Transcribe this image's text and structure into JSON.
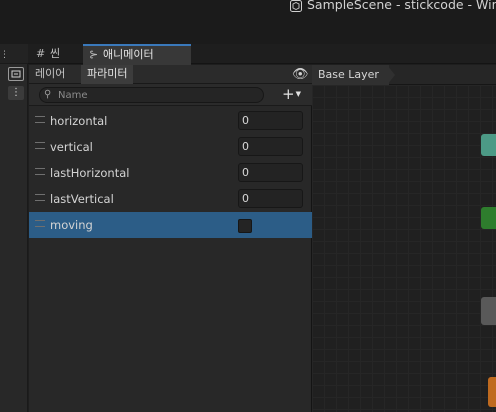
{
  "window": {
    "title": "SampleScene - stickcode - Win"
  },
  "tabs": [
    {
      "label": "씬",
      "icon": "grid-icon"
    },
    {
      "label": "애니메이터",
      "icon": "animator-icon",
      "active": true
    }
  ],
  "animator": {
    "subtabs": {
      "layers": "레이어",
      "parameters": "파라미터"
    },
    "search": {
      "placeholder": "Name",
      "value": ""
    },
    "add_label": "+",
    "breadcrumb": "Base Layer",
    "parameters": [
      {
        "name": "horizontal",
        "value": "0",
        "type": "float"
      },
      {
        "name": "vertical",
        "value": "0",
        "type": "float"
      },
      {
        "name": "lastHorizontal",
        "value": "0",
        "type": "float"
      },
      {
        "name": "lastVertical",
        "value": "0",
        "type": "float"
      },
      {
        "name": "moving",
        "value": false,
        "type": "bool",
        "selected": true
      }
    ]
  },
  "colors": {
    "accent": "#3a79bb",
    "selected_row": "#2c5d87",
    "node_teal": "#4c9a86",
    "node_green": "#2e7d2d",
    "node_gray": "#595959",
    "node_orange": "#bf6a1f"
  }
}
